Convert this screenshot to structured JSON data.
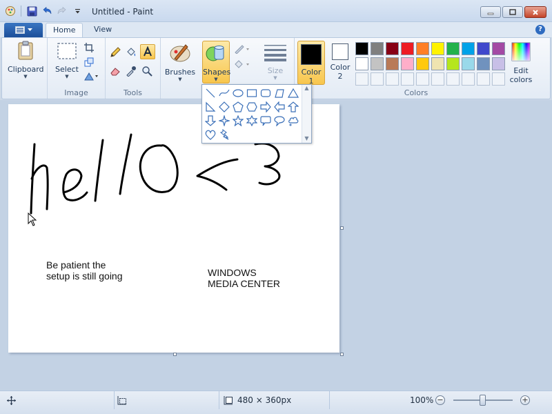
{
  "window": {
    "title": "Untitled - Paint"
  },
  "tabs": [
    {
      "label": "Home",
      "active": true
    },
    {
      "label": "View",
      "active": false
    }
  ],
  "ribbon": {
    "groups": {
      "clipboard": {
        "label": "Clipboard"
      },
      "image": {
        "label": "Image",
        "select_label": "Select"
      },
      "tools": {
        "label": "Tools"
      },
      "brushes": {
        "label": "Brushes"
      },
      "shapes": {
        "label": "Shapes"
      },
      "size": {
        "label": "Size"
      },
      "color1": {
        "label_line1": "Color",
        "label_line2": "1",
        "value": "#000000"
      },
      "color2": {
        "label_line1": "Color",
        "label_line2": "2",
        "value": "#ffffff"
      },
      "colors": {
        "label": "Colors"
      },
      "edit_colors": {
        "label_line1": "Edit",
        "label_line2": "colors"
      }
    },
    "palette": [
      "#000000",
      "#7f7f7f",
      "#880015",
      "#ed1c24",
      "#ff7f27",
      "#fff200",
      "#22b14c",
      "#00a2e8",
      "#3f48cc",
      "#a349a4",
      "#ffffff",
      "#c3c3c3",
      "#b97a57",
      "#ffaec9",
      "#ffc90e",
      "#efe4b0",
      "#b5e61d",
      "#99d9ea",
      "#7092be",
      "#c8bfe7"
    ]
  },
  "shapes_menu": {
    "items": [
      "line-shape-icon",
      "curve-shape-icon",
      "oval-shape-icon",
      "rectangle-shape-icon",
      "rounded-rectangle-shape-icon",
      "polygon-shape-icon",
      "triangle-shape-icon",
      "right-triangle-shape-icon",
      "diamond-shape-icon",
      "pentagon-shape-icon",
      "hexagon-shape-icon",
      "right-arrow-shape-icon",
      "left-arrow-shape-icon",
      "up-arrow-shape-icon",
      "down-arrow-shape-icon",
      "four-point-star-shape-icon",
      "five-point-star-shape-icon",
      "six-point-star-shape-icon",
      "rounded-callout-shape-icon",
      "oval-callout-shape-icon",
      "cloud-callout-shape-icon",
      "heart-shape-icon",
      "lightning-shape-icon"
    ]
  },
  "canvas": {
    "text_left": {
      "line1": "Be patient the",
      "line2": "setup is still going"
    },
    "text_right": {
      "line1": "WINDOWS",
      "line2": "MEDIA CENTER"
    },
    "handwriting": "hello<3"
  },
  "status": {
    "image_size": "480 × 360px",
    "zoom": "100%",
    "zoom_level_percent": 100
  }
}
